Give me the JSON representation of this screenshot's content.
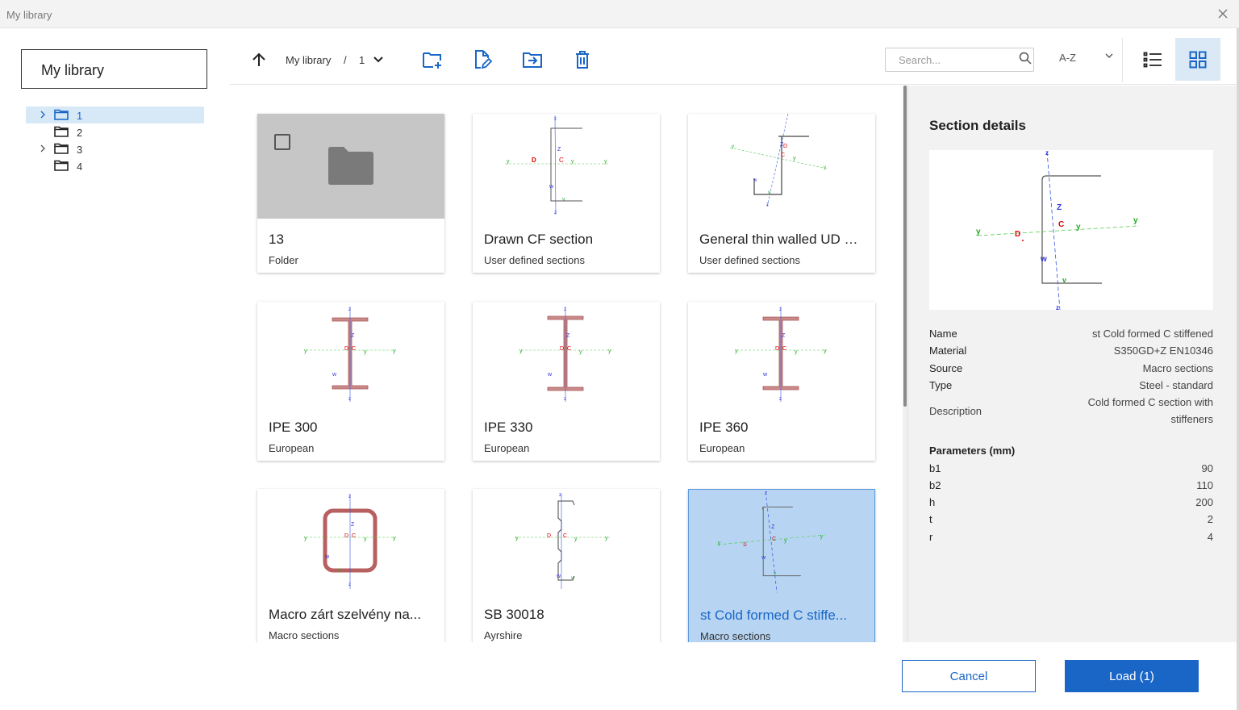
{
  "window": {
    "title": "My library"
  },
  "sidebar": {
    "title": "My library",
    "tree": [
      {
        "label": "1",
        "expandable": true,
        "selected": true
      },
      {
        "label": "2",
        "expandable": false,
        "selected": false
      },
      {
        "label": "3",
        "expandable": true,
        "selected": false
      },
      {
        "label": "4",
        "expandable": false,
        "selected": false
      }
    ]
  },
  "toolbar": {
    "breadcrumb_root": "My library",
    "breadcrumb_sep": "/",
    "breadcrumb_current": "1",
    "search_placeholder": "Search...",
    "sort_label": "A-Z"
  },
  "cards": [
    {
      "name": "13",
      "category": "Folder",
      "kind": "folder"
    },
    {
      "name": "Drawn CF section",
      "category": "User defined sections",
      "kind": "c-section"
    },
    {
      "name": "General thin walled UD …",
      "category": "User defined sections",
      "kind": "z-section"
    },
    {
      "name": "IPE 300",
      "category": "European",
      "kind": "i-beam"
    },
    {
      "name": "IPE 330",
      "category": "European",
      "kind": "i-beam"
    },
    {
      "name": "IPE 360",
      "category": "European",
      "kind": "i-beam"
    },
    {
      "name": "Macro zárt szelvény na...",
      "category": "Macro sections",
      "kind": "rect-tube"
    },
    {
      "name": "SB 30018",
      "category": "Ayrshire",
      "kind": "sigma"
    },
    {
      "name": "st Cold formed C stiffe...",
      "category": "Macro sections",
      "kind": "c-stiff",
      "selected": true
    }
  ],
  "details": {
    "title": "Section details",
    "props": [
      {
        "key": "Name",
        "value": "st Cold formed C stiffened"
      },
      {
        "key": "Material",
        "value": "S350GD+Z EN10346"
      },
      {
        "key": "Source",
        "value": "Macro sections"
      },
      {
        "key": "Type",
        "value": "Steel - standard"
      }
    ],
    "description_label": "Description",
    "description_value": "Cold formed C section with stiffeners",
    "params_title": "Parameters (mm)",
    "params": [
      {
        "key": "b1",
        "value": "90"
      },
      {
        "key": "b2",
        "value": "110"
      },
      {
        "key": "h",
        "value": "200"
      },
      {
        "key": "t",
        "value": "2"
      },
      {
        "key": "r",
        "value": "4"
      }
    ]
  },
  "footer": {
    "cancel_label": "Cancel",
    "load_label": "Load (1)"
  },
  "colors": {
    "accent": "#1a66c6",
    "selected_card": "#b7d5f3",
    "tree_selected": "#d7e8f7",
    "steel_fill": "#c98a8a"
  }
}
